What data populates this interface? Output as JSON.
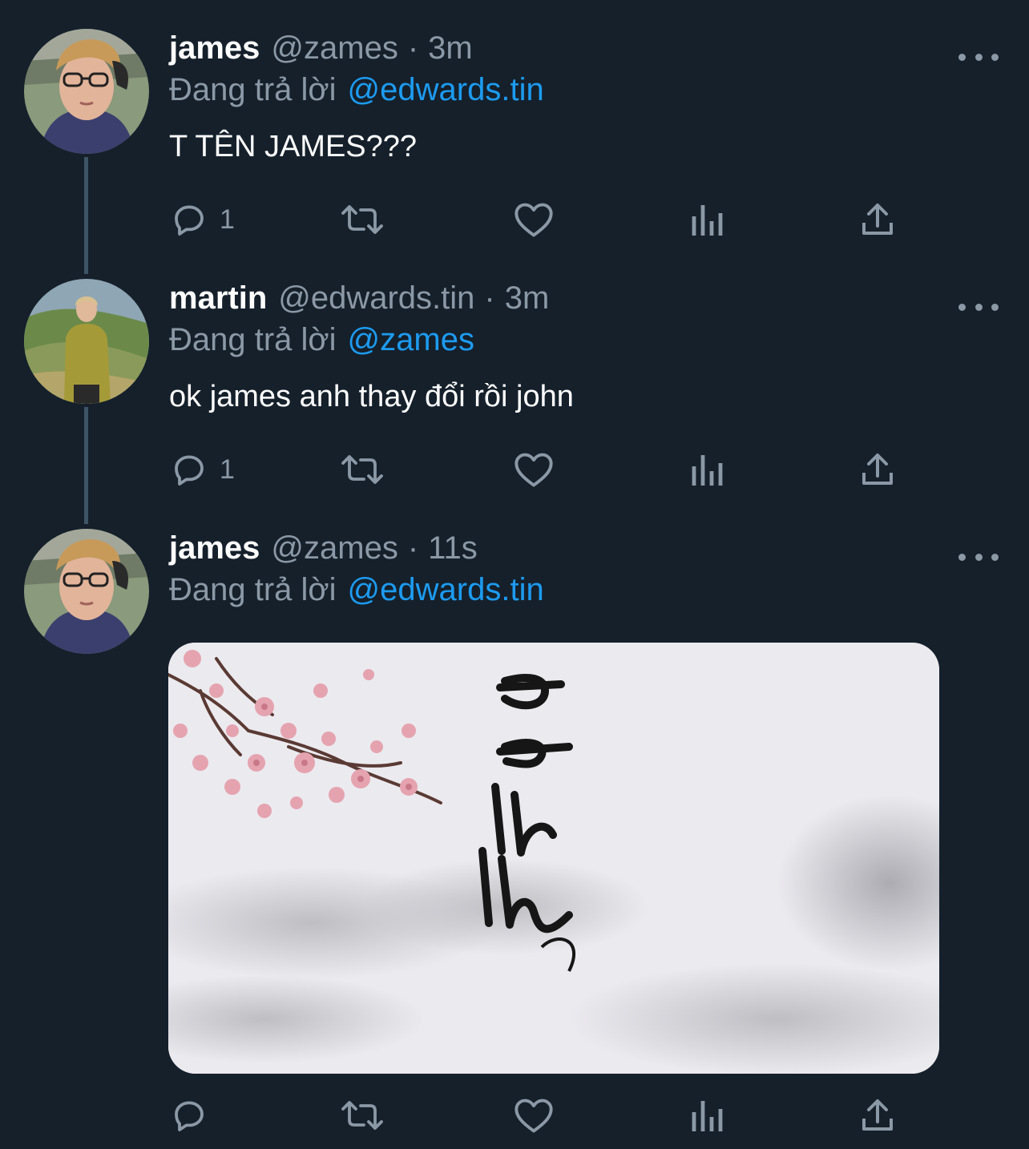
{
  "tweets": [
    {
      "name": "james",
      "handle": "@zames",
      "separator": "·",
      "time": "3m",
      "replying_label": "Đang trả lời",
      "replying_to": "@edwards.tin",
      "text": "T TÊN JAMES???",
      "reply_count": "1"
    },
    {
      "name": "martin",
      "handle": "@edwards.tin",
      "separator": "·",
      "time": "3m",
      "replying_label": "Đang trả lời",
      "replying_to": "@zames",
      "text": "ok james anh thay đổi rồi john",
      "reply_count": "1"
    },
    {
      "name": "james",
      "handle": "@zames",
      "separator": "·",
      "time": "11s",
      "replying_label": "Đang trả lời",
      "replying_to": "@edwards.tin",
      "text": "",
      "reply_count": ""
    }
  ],
  "icons": {
    "reply": "speech-bubble-icon",
    "retweet": "retweet-arrows-icon",
    "like": "heart-icon",
    "analytics": "bar-chart-icon",
    "share": "share-upload-icon",
    "more": "three-dots-icon"
  },
  "colors": {
    "background": "#15202b",
    "mention": "#1d9bf0",
    "muted": "#8b98a5",
    "thread_line": "#3d5466"
  }
}
